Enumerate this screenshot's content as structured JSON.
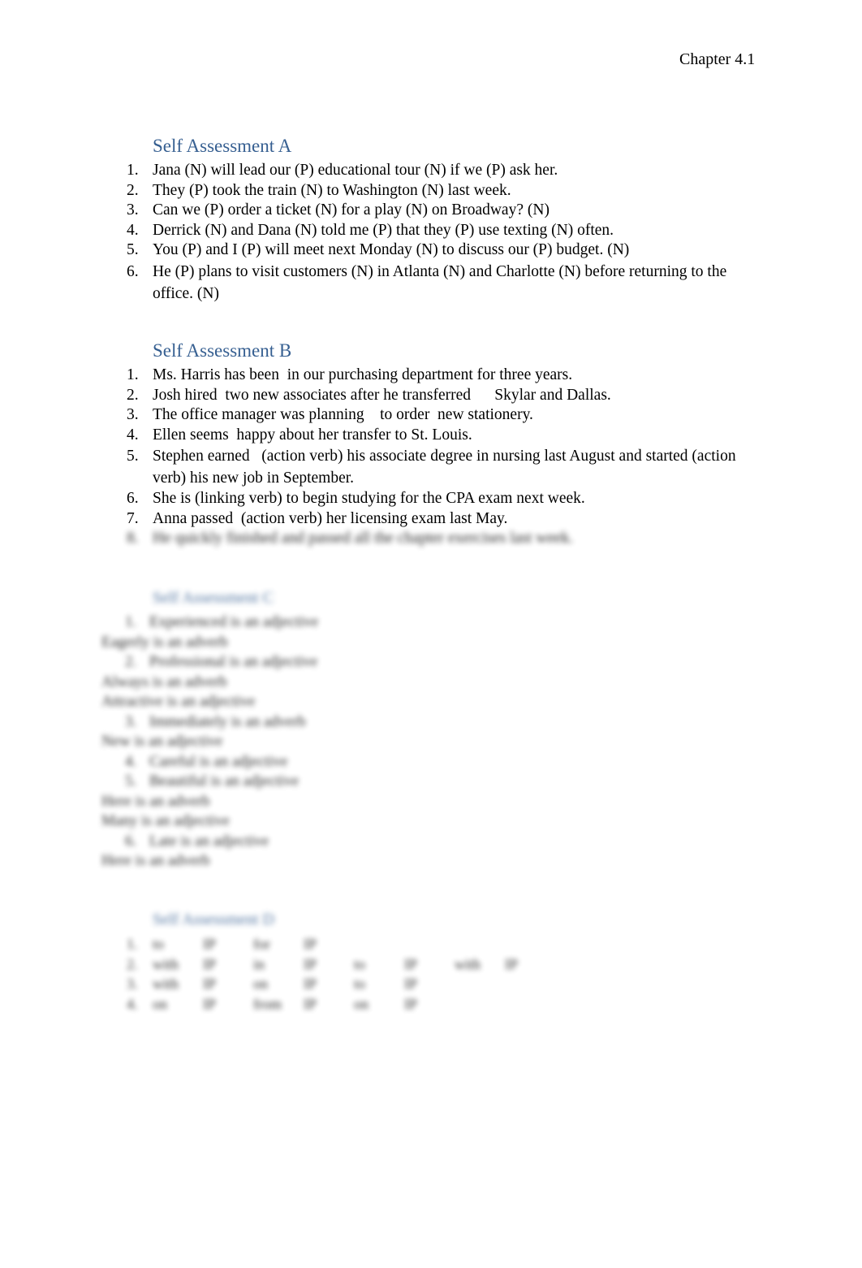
{
  "header": {
    "chapter": "Chapter 4.1"
  },
  "sections": [
    {
      "title": "Self Assessment A",
      "items": [
        {
          "num": "1.",
          "text": "Jana (N) will lead our (P) educational tour (N) if we (P) ask her."
        },
        {
          "num": "2.",
          "text": "They (P) took the train (N) to Washington (N) last week."
        },
        {
          "num": "3.",
          "text": "Can we (P) order a ticket (N) for a play (N) on Broadway? (N)"
        },
        {
          "num": "4.",
          "text": "Derrick (N) and Dana (N) told me (P) that they (P) use texting (N) often."
        },
        {
          "num": "5.",
          "text": "You (P) and I (P) will meet next Monday (N) to discuss our (P) budget. (N)"
        },
        {
          "num": "6.",
          "text": "He (P) plans to visit customers (N) in Atlanta (N) and Charlotte (N) before returning to the office. (N)"
        }
      ]
    },
    {
      "title": "Self Assessment B",
      "items": [
        {
          "num": "1.",
          "text": "Ms. Harris has been  in our purchasing department for three years."
        },
        {
          "num": "2.",
          "text": "Josh hired  two new associates after he transferred      Skylar and Dallas."
        },
        {
          "num": "3.",
          "text": "The office manager was planning    to order  new stationery."
        },
        {
          "num": "4.",
          "text": "Ellen seems  happy about her transfer to St. Louis."
        },
        {
          "num": "5.",
          "text": "Stephen earned   (action verb) his associate degree in nursing last August and started (action verb) his new job in September."
        },
        {
          "num": "6.",
          "text": "She is (linking verb) to begin studying for the CPA exam next week."
        },
        {
          "num": "7.",
          "text": "Anna passed  (action verb) her licensing exam last May."
        }
      ],
      "blurred_item": {
        "num": "8.",
        "text": "He quickly finished and passed all the chapter exercises last week."
      }
    }
  ],
  "blurred": {
    "section_c": {
      "title": "Self Assessment C",
      "lines": [
        {
          "indent": true,
          "num": "1.",
          "text": "Experienced is an adjective"
        },
        {
          "indent": false,
          "num": "",
          "text": "Eagerly is an adverb"
        },
        {
          "indent": true,
          "num": "2.",
          "text": "Professional is an adjective"
        },
        {
          "indent": false,
          "num": "",
          "text": "Always is an adverb"
        },
        {
          "indent": false,
          "num": "",
          "text": "Attractive is an adjective"
        },
        {
          "indent": true,
          "num": "3.",
          "text": "Immediately is an adverb"
        },
        {
          "indent": false,
          "num": "",
          "text": "New is an adjective"
        },
        {
          "indent": true,
          "num": "4.",
          "text": "Careful is an adjective"
        },
        {
          "indent": true,
          "num": "5.",
          "text": "Beautiful is an adjective"
        },
        {
          "indent": false,
          "num": "",
          "text": "Here is an adverb"
        },
        {
          "indent": false,
          "num": "",
          "text": "Many is an adjective"
        },
        {
          "indent": true,
          "num": "6.",
          "text": "Late is an adjective"
        },
        {
          "indent": false,
          "num": "",
          "text": "Here is an adverb"
        }
      ]
    },
    "section_d": {
      "title": "Self Assessment D",
      "rows": [
        {
          "num": "1.",
          "cells": [
            "to",
            "IP",
            "for",
            "IP"
          ]
        },
        {
          "num": "2.",
          "cells": [
            "with",
            "IP",
            "in",
            "IP",
            "to",
            "IP",
            "with",
            "IP"
          ]
        },
        {
          "num": "3.",
          "cells": [
            "with",
            "IP",
            "on",
            "IP",
            "to",
            "IP"
          ]
        },
        {
          "num": "4.",
          "cells": [
            "on",
            "IP",
            "from",
            "IP",
            "on",
            "IP"
          ]
        }
      ]
    }
  }
}
